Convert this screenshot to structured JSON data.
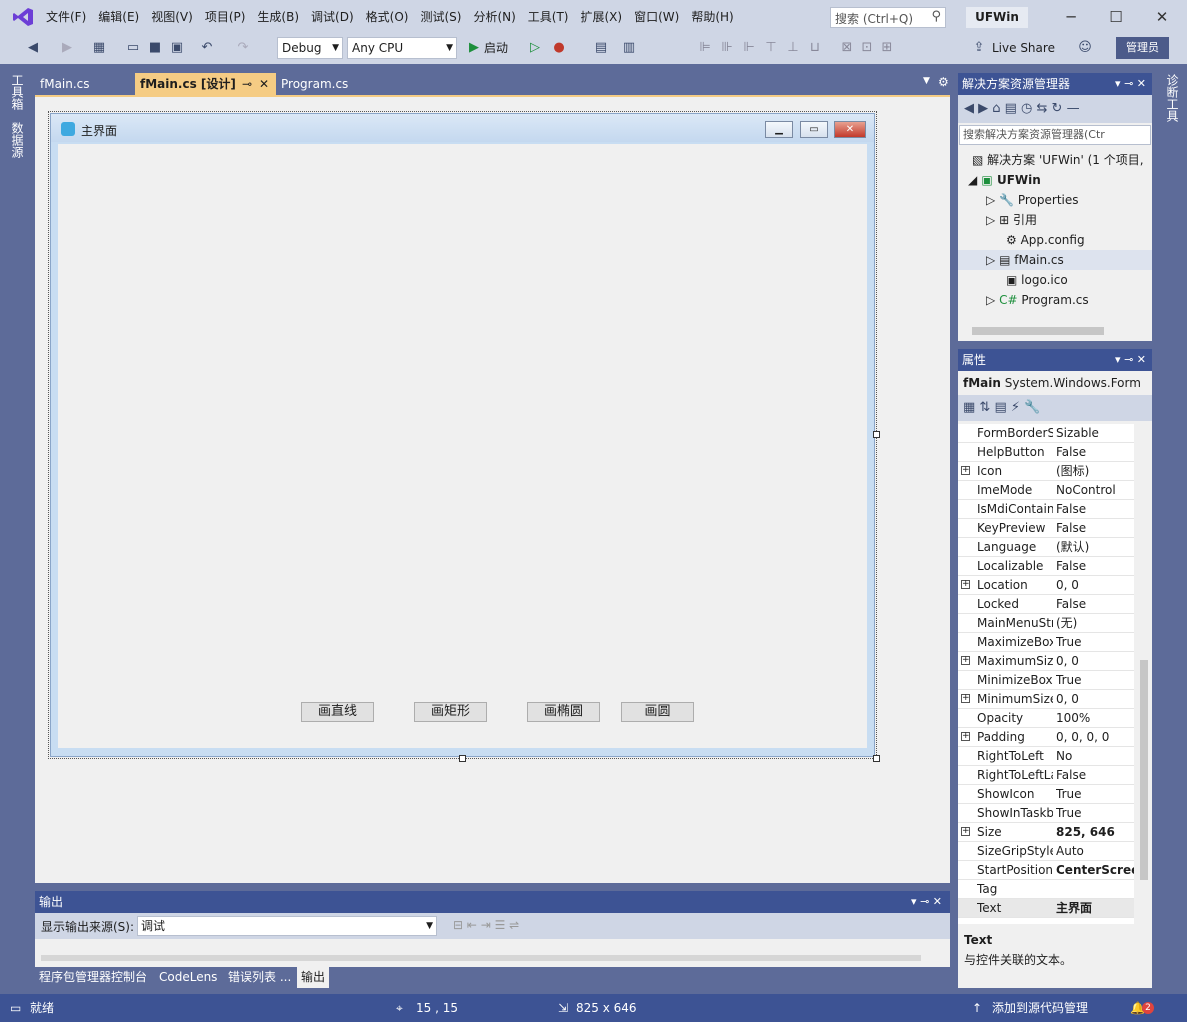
{
  "menubar": {
    "items": [
      "文件(F)",
      "编辑(E)",
      "视图(V)",
      "项目(P)",
      "生成(B)",
      "调试(D)",
      "格式(O)",
      "测试(S)",
      "分析(N)",
      "工具(T)",
      "扩展(X)",
      "窗口(W)",
      "帮助(H)"
    ],
    "search_placeholder": "搜索 (Ctrl+Q)",
    "app_name": "UFWin"
  },
  "toolbar": {
    "config": "Debug",
    "platform": "Any CPU",
    "start_label": "启动",
    "live_share": "Live Share",
    "admin": "管理员"
  },
  "left_sidetabs": [
    "工具箱",
    "数据源"
  ],
  "right_sidetabs": [
    "诊断工具"
  ],
  "doc_tabs": [
    {
      "label": "fMain.cs"
    },
    {
      "label": "fMain.cs [设计]"
    },
    {
      "label": "Program.cs"
    }
  ],
  "form": {
    "title": "主界面",
    "buttons": [
      "画直线",
      "画矩形",
      "画椭圆",
      "画圆"
    ]
  },
  "output": {
    "title": "输出",
    "source_label": "显示输出来源(S):",
    "source_value": "调试"
  },
  "bottom_tabs": [
    "程序包管理器控制台",
    "CodeLens",
    "错误列表 ...",
    "输出"
  ],
  "solution": {
    "title": "解决方案资源管理器",
    "search_placeholder": "搜索解决方案资源管理器(Ctr",
    "solution_node": "解决方案 'UFWin' (1 个项目,",
    "project": "UFWin",
    "items": [
      "Properties",
      "引用",
      "App.config",
      "fMain.cs",
      "logo.ico",
      "Program.cs"
    ]
  },
  "properties": {
    "title": "属性",
    "object_name": "fMain",
    "object_type": "System.Windows.Form",
    "rows": [
      {
        "name": "FormBorderStyle",
        "value": "Sizable"
      },
      {
        "name": "HelpButton",
        "value": "False"
      },
      {
        "name": "Icon",
        "value": "(图标)"
      },
      {
        "name": "ImeMode",
        "value": "NoControl"
      },
      {
        "name": "IsMdiContainer",
        "value": "False"
      },
      {
        "name": "KeyPreview",
        "value": "False"
      },
      {
        "name": "Language",
        "value": "(默认)"
      },
      {
        "name": "Localizable",
        "value": "False"
      },
      {
        "name": "Location",
        "value": "0, 0"
      },
      {
        "name": "Locked",
        "value": "False"
      },
      {
        "name": "MainMenuStrip",
        "value": "(无)"
      },
      {
        "name": "MaximizeBox",
        "value": "True"
      },
      {
        "name": "MaximumSize",
        "value": "0, 0"
      },
      {
        "name": "MinimizeBox",
        "value": "True"
      },
      {
        "name": "MinimumSize",
        "value": "0, 0"
      },
      {
        "name": "Opacity",
        "value": "100%"
      },
      {
        "name": "Padding",
        "value": "0, 0, 0, 0"
      },
      {
        "name": "RightToLeft",
        "value": "No"
      },
      {
        "name": "RightToLeftLayout",
        "value": "False"
      },
      {
        "name": "ShowIcon",
        "value": "True"
      },
      {
        "name": "ShowInTaskbar",
        "value": "True"
      },
      {
        "name": "Size",
        "value": "825, 646"
      },
      {
        "name": "SizeGripStyle",
        "value": "Auto"
      },
      {
        "name": "StartPosition",
        "value": "CenterScreen"
      },
      {
        "name": "Tag",
        "value": ""
      },
      {
        "name": "Text",
        "value": "主界面"
      }
    ],
    "desc_title": "Text",
    "desc_text": "与控件关联的文本。"
  },
  "status": {
    "ready": "就绪",
    "position": "15 , 15",
    "size": "825 x 646",
    "source_control": "添加到源代码管理",
    "notifications": "2"
  }
}
